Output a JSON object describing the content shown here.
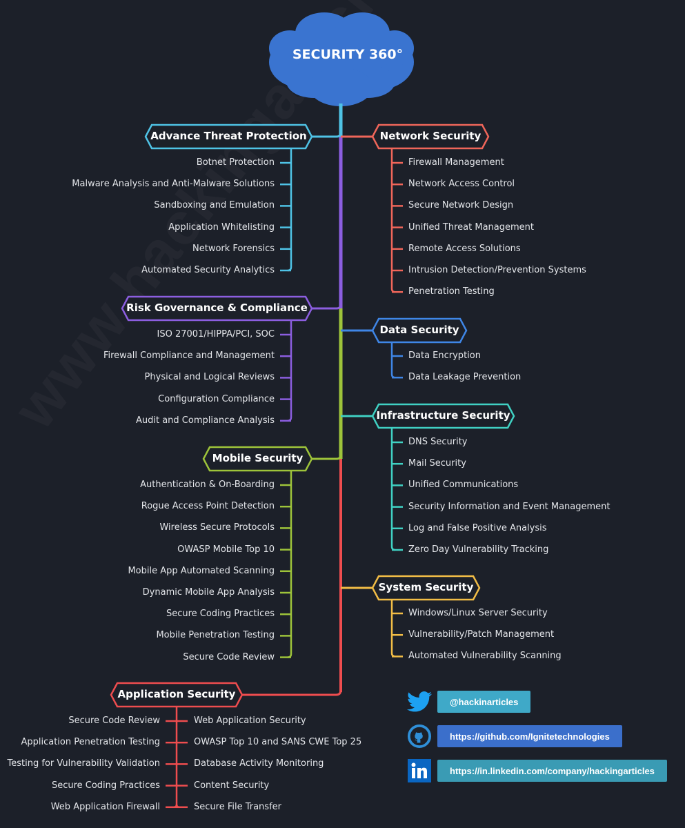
{
  "title": "SECURITY 360°",
  "watermark": "www.hackingarticles.in",
  "colors": {
    "background": "#1c2029",
    "cloud": "#3a74d0",
    "trunk": "#5bc8ea"
  },
  "categories": [
    {
      "name": "Advance Threat Protection",
      "side": "left",
      "color": "#4fc3e6",
      "items": [
        "Botnet Protection",
        "Malware Analysis and Anti-Malware Solutions",
        "Sandboxing and Emulation",
        "Application Whitelisting",
        "Network Forensics",
        "Automated Security Analytics"
      ]
    },
    {
      "name": "Network Security",
      "side": "right",
      "color": "#f0665a",
      "items": [
        "Firewall Management",
        "Network Access Control",
        "Secure Network Design",
        "Unified Threat Management",
        "Remote Access Solutions",
        "Intrusion Detection/Prevention Systems",
        "Penetration Testing"
      ]
    },
    {
      "name": "Risk Governance & Compliance",
      "side": "left",
      "color": "#8c5ee0",
      "items": [
        "ISO 27001/HIPPA/PCI, SOC",
        "Firewall Compliance and Management",
        "Physical and Logical Reviews",
        "Configuration Compliance",
        "Audit and Compliance Analysis"
      ]
    },
    {
      "name": "Data Security",
      "side": "right",
      "color": "#3f86e6",
      "items": [
        "Data Encryption",
        "Data Leakage Prevention"
      ]
    },
    {
      "name": "Infrastructure Security",
      "side": "right",
      "color": "#40d1c3",
      "items": [
        "DNS Security",
        "Mail Security",
        "Unified Communications",
        "Security Information and Event Management",
        "Log and False Positive Analysis",
        "Zero Day Vulnerability Tracking"
      ]
    },
    {
      "name": "Mobile Security",
      "side": "left",
      "color": "#9ec43a",
      "items": [
        "Authentication & On-Boarding",
        "Rogue Access Point Detection",
        "Wireless Secure Protocols",
        "OWASP Mobile Top 10",
        "Mobile App Automated Scanning",
        "Dynamic Mobile App Analysis",
        "Secure Coding Practices",
        "Mobile Penetration Testing",
        "Secure Code Review"
      ]
    },
    {
      "name": "System Security",
      "side": "right",
      "color": "#f2bd46",
      "items": [
        "Windows/Linux Server Security",
        "Vulnerability/Patch Management",
        "Automated Vulnerability Scanning"
      ]
    },
    {
      "name": "Application Security",
      "side": "both",
      "color": "#ef4d4f",
      "items_left": [
        "Secure Code Review",
        "Application Penetration Testing",
        "Testing for Vulnerability Validation",
        "Secure Coding Practices",
        "Web Application Firewall"
      ],
      "items_right": [
        "Web Application Security",
        "OWASP Top 10 and SANS CWE Top 25",
        "Database Activity Monitoring",
        "Content Security",
        "Secure File Transfer"
      ]
    }
  ],
  "social": [
    {
      "icon": "twitter-icon",
      "label": "@hackinarticles",
      "color": "#3fa9c8",
      "icon_color": "#1da1f2"
    },
    {
      "icon": "github-icon",
      "label": "https://github.com/Ignitetechnologies",
      "color": "#3b6fcb",
      "icon_color": "#2f8fd8"
    },
    {
      "icon": "linkedin-icon",
      "label": "https://in.linkedin.com/company/hackingarticles",
      "color": "#3a9bb4",
      "icon_color": "#0a66c2"
    }
  ]
}
